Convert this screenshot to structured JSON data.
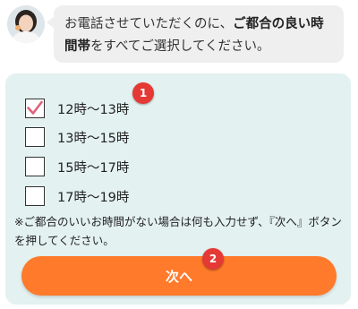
{
  "header": {
    "avatar_icon": "operator-avatar-icon",
    "message_parts": [
      "お電話させていただくのに、",
      "ご都合の良い時間帯",
      "をすべてご選択してください。"
    ]
  },
  "form": {
    "options": [
      {
        "label": "12時～13時",
        "checked": true
      },
      {
        "label": "13時～15時",
        "checked": false
      },
      {
        "label": "15時～17時",
        "checked": false
      },
      {
        "label": "17時～19時",
        "checked": false
      }
    ],
    "note": "※ご都合のいいお時間がない場合は何も入力せず、『次へ』ボタンを押してください。",
    "next_label": "次へ"
  },
  "markers": [
    "1",
    "2"
  ],
  "colors": {
    "accent": "#ff7a2a",
    "card_bg": "#e3f1f0",
    "bubble_bg": "#efefef",
    "check": "#e0637a",
    "marker": "#e53935"
  }
}
